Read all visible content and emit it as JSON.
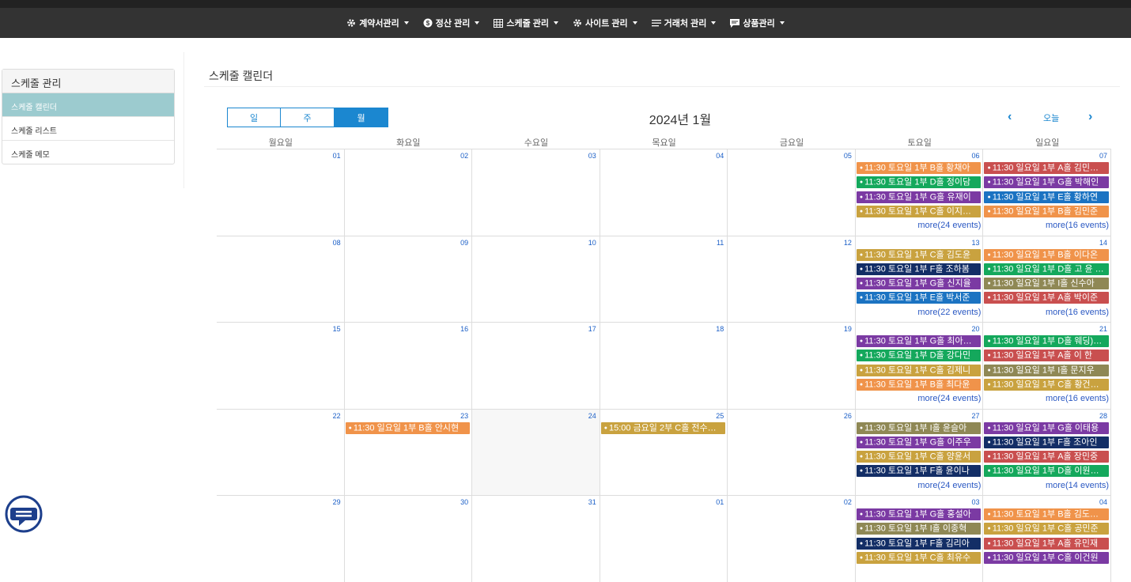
{
  "nav": [
    {
      "label": "계약서관리",
      "icon": "gear-icon"
    },
    {
      "label": "정산 관리",
      "icon": "dollar-circle-icon"
    },
    {
      "label": "스케줄 관리",
      "icon": "grid-icon"
    },
    {
      "label": "사이트 관리",
      "icon": "gear-icon"
    },
    {
      "label": "거래처 관리",
      "icon": "list-icon"
    },
    {
      "label": "상품관리",
      "icon": "message-icon"
    }
  ],
  "sidebar": {
    "title": "스케줄 관리",
    "items": [
      {
        "label": "스케줄 캘린더",
        "active": true
      },
      {
        "label": "스케줄 리스트",
        "active": false
      },
      {
        "label": "스케줄 메모",
        "active": false
      }
    ]
  },
  "page": {
    "title": "스케줄 캘린더"
  },
  "calendar": {
    "views": [
      {
        "label": "일",
        "active": false
      },
      {
        "label": "주",
        "active": false
      },
      {
        "label": "월",
        "active": true
      }
    ],
    "title": "2024년 1월",
    "today_label": "오늘",
    "prev_icon": "chevron-left-icon",
    "next_icon": "chevron-right-icon",
    "dow": [
      "월요일",
      "화요일",
      "수요일",
      "목요일",
      "금요일",
      "토요일",
      "일요일"
    ],
    "colors": {
      "orange": "#f0934a",
      "red": "#c94f4f",
      "green": "#14a85c",
      "purple": "#7b3aa3",
      "blue": "#1b73c2",
      "gold": "#c9a23f",
      "navy": "#132e66",
      "olive": "#8f8855"
    },
    "weeks": [
      {
        "days": [
          {
            "num": "01",
            "events": []
          },
          {
            "num": "02",
            "events": []
          },
          {
            "num": "03",
            "events": []
          },
          {
            "num": "04",
            "events": []
          },
          {
            "num": "05",
            "events": []
          },
          {
            "num": "06",
            "events": [
              {
                "time": "11:30",
                "text": "토요일 1부 B홀 황채아",
                "color": "orange"
              },
              {
                "time": "11:30",
                "text": "토요일 1부 D홀 정이담",
                "color": "green"
              },
              {
                "time": "11:30",
                "text": "토요일 1부 G홀 유재이",
                "color": "purple"
              },
              {
                "time": "11:30",
                "text": "토요일 1부 C홀 이지환,...",
                "color": "gold"
              }
            ],
            "more": "more(24 events)"
          },
          {
            "num": "07",
            "events": [
              {
                "time": "11:30",
                "text": "일요일 1부 A홀 김민재•••",
                "color": "red"
              },
              {
                "time": "11:30",
                "text": "일요일 1부 G홀 박해인",
                "color": "purple"
              },
              {
                "time": "11:30",
                "text": "일요일 1부 E홀 황하연",
                "color": "blue"
              },
              {
                "time": "11:30",
                "text": "일요일 1부 B홀 김민준",
                "color": "orange"
              }
            ],
            "more": "more(16 events)"
          }
        ]
      },
      {
        "days": [
          {
            "num": "08",
            "events": []
          },
          {
            "num": "09",
            "events": []
          },
          {
            "num": "10",
            "events": []
          },
          {
            "num": "11",
            "events": []
          },
          {
            "num": "12",
            "events": []
          },
          {
            "num": "13",
            "events": [
              {
                "time": "11:30",
                "text": "토요일 1부 C홀 김도윤",
                "color": "gold"
              },
              {
                "time": "11:30",
                "text": "토요일 1부 F홀 조하봄",
                "color": "navy"
              },
              {
                "time": "11:30",
                "text": "토요일 1부 G홀 신지율",
                "color": "purple"
              },
              {
                "time": "11:30",
                "text": "토요일 1부 E홀 박서준",
                "color": "blue"
              }
            ],
            "more": "more(22 events)"
          },
          {
            "num": "14",
            "events": [
              {
                "time": "11:30",
                "text": "일요일 1부 B홀 이다온",
                "color": "orange"
              },
              {
                "time": "11:30",
                "text": "일요일 1부 D홀 고 윤 아...",
                "color": "green"
              },
              {
                "time": "11:30",
                "text": "일요일 1부 I홀 신수아",
                "color": "olive"
              },
              {
                "time": "11:30",
                "text": "일요일 1부 A홀 박이준",
                "color": "red"
              }
            ],
            "more": "more(16 events)"
          }
        ]
      },
      {
        "days": [
          {
            "num": "15",
            "events": []
          },
          {
            "num": "16",
            "events": []
          },
          {
            "num": "17",
            "events": []
          },
          {
            "num": "18",
            "events": []
          },
          {
            "num": "19",
            "events": []
          },
          {
            "num": "20",
            "events": [
              {
                "time": "11:30",
                "text": "토요일 1부 G홀 최아윤 ...",
                "color": "purple"
              },
              {
                "time": "11:30",
                "text": "토요일 1부 D홀 강다민",
                "color": "green"
              },
              {
                "time": "11:30",
                "text": "토요일 1부 C홀 김제니",
                "color": "gold"
              },
              {
                "time": "11:30",
                "text": "토요일 1부 B홀 최다윤",
                "color": "orange"
              }
            ],
            "more": "more(24 events)"
          },
          {
            "num": "21",
            "events": [
              {
                "time": "11:30",
                "text": "일요일 1부 D홀 웨딩)김...",
                "color": "green"
              },
              {
                "time": "11:30",
                "text": "일요일 1부 A홀 이 한",
                "color": "red"
              },
              {
                "time": "11:30",
                "text": "일요일 1부 I홀 문지우",
                "color": "olive"
              },
              {
                "time": "11:30",
                "text": "일요일 1부 C홀 황건웅,...",
                "color": "gold"
              }
            ],
            "more": "more(16 events)"
          }
        ]
      },
      {
        "days": [
          {
            "num": "22",
            "events": []
          },
          {
            "num": "23",
            "events": [
              {
                "time": "11:30",
                "text": "일요일 1부 B홀 안시현",
                "color": "orange"
              }
            ]
          },
          {
            "num": "24",
            "events": [],
            "today": true
          },
          {
            "num": "25",
            "events": [
              {
                "time": "15:00",
                "text": "금요일 2부 C홀 전수현 ...",
                "color": "gold"
              }
            ]
          },
          {
            "num": "26",
            "events": []
          },
          {
            "num": "27",
            "events": [
              {
                "time": "11:30",
                "text": "토요일 1부 I홀 윤슬아",
                "color": "olive"
              },
              {
                "time": "11:30",
                "text": "토요일 1부 G홀 이주우",
                "color": "purple"
              },
              {
                "time": "11:30",
                "text": "토요일 1부 C홀 양윤서",
                "color": "gold"
              },
              {
                "time": "11:30",
                "text": "토요일 1부 F홀 윤이나",
                "color": "navy"
              }
            ],
            "more": "more(24 events)"
          },
          {
            "num": "28",
            "events": [
              {
                "time": "11:30",
                "text": "일요일 1부 G홀 이태용",
                "color": "purple"
              },
              {
                "time": "11:30",
                "text": "일요일 1부 F홀 조아인",
                "color": "navy"
              },
              {
                "time": "11:30",
                "text": "일요일 1부 A홀 장민중",
                "color": "red"
              },
              {
                "time": "11:30",
                "text": "일요일 1부 D홀 이원학 ...",
                "color": "green"
              }
            ],
            "more": "more(14 events)"
          }
        ]
      },
      {
        "days": [
          {
            "num": "29",
            "events": []
          },
          {
            "num": "30",
            "events": []
          },
          {
            "num": "31",
            "events": []
          },
          {
            "num": "01",
            "events": []
          },
          {
            "num": "02",
            "events": []
          },
          {
            "num": "03",
            "events": [
              {
                "time": "11:30",
                "text": "토요일 1부 G홀 홍설아",
                "color": "purple"
              },
              {
                "time": "11:30",
                "text": "토요일 1부 I홀 이종혁",
                "color": "olive"
              },
              {
                "time": "11:30",
                "text": "토요일 1부 F홀 김리아",
                "color": "navy"
              },
              {
                "time": "11:30",
                "text": "토요일 1부 C홀 최유수",
                "color": "gold"
              }
            ]
          },
          {
            "num": "04",
            "events": [
              {
                "time": "11:30",
                "text": "토요일 1부 B홀 김도아 ...",
                "color": "orange"
              },
              {
                "time": "11:30",
                "text": "일요일 1부 C홀 공민준",
                "color": "gold"
              },
              {
                "time": "11:30",
                "text": "일요일 1부 A홀 유민재",
                "color": "red"
              },
              {
                "time": "11:30",
                "text": "일요일 1부 C홀 이건원",
                "color": "purple"
              }
            ]
          }
        ]
      }
    ]
  },
  "chat_icon": "chat-bubble-icon"
}
